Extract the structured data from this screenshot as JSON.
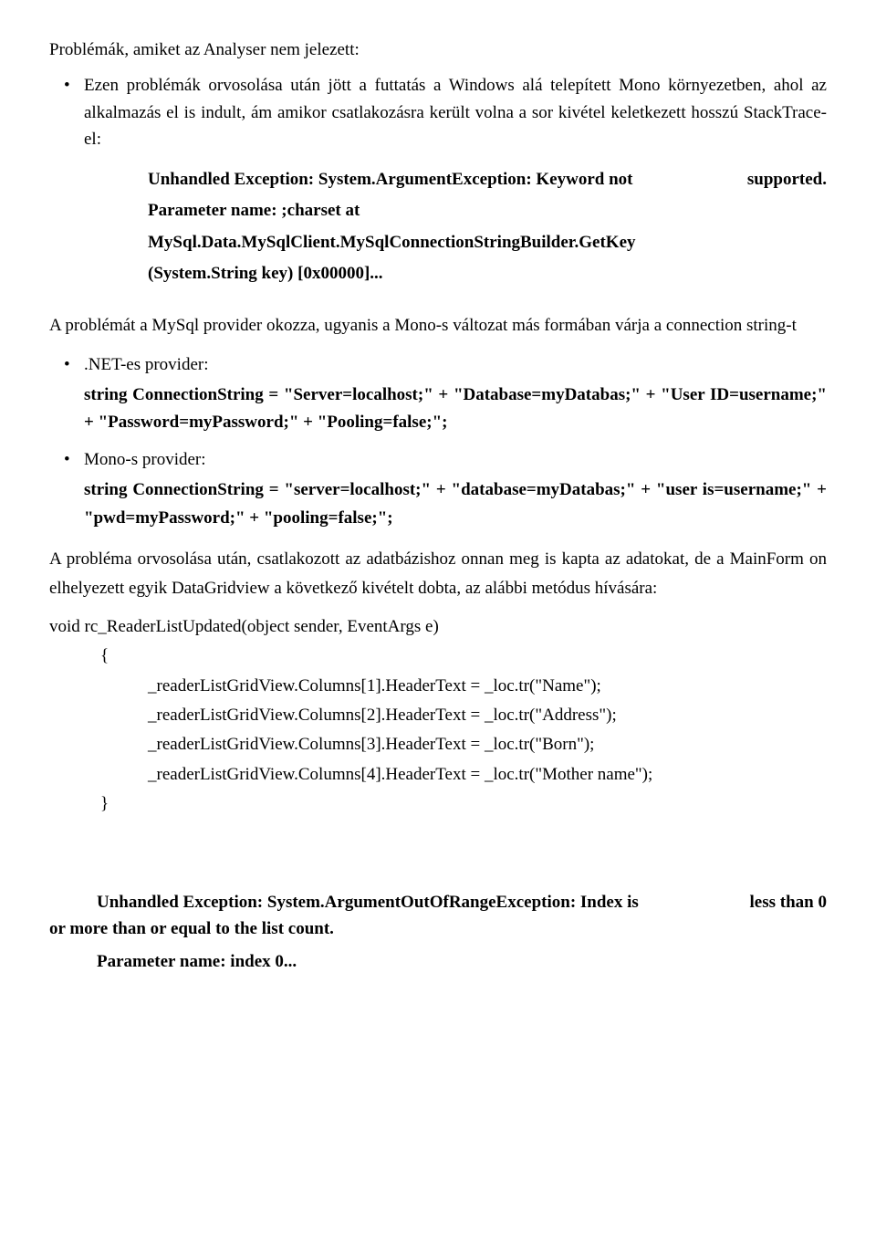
{
  "title": "Problémák, amiket az Analyser nem jelezett:",
  "bullet1": "Ezen problémák orvosolása után jött a futtatás a Windows alá telepített Mono környezetben, ahol az alkalmazás el is indult, ám amikor csatlakozásra került volna a sor kivétel keletkezett hosszú StackTrace-el:",
  "stack1": {
    "l1_left": "Unhandled Exception: System.ArgumentException: Keyword not",
    "l1_right": "supported.",
    "l2": "Parameter name: ;charset at",
    "l3": "MySql.Data.MySqlClient.MySqlConnectionStringBuilder.GetKey",
    "l4": "(System.String key) [0x00000]..."
  },
  "para1": "A problémát a MySql provider okozza, ugyanis a Mono-s változat más formában várja a connection string-t",
  "provider_net_label": ".NET-es provider:",
  "provider_net_code": "string ConnectionString = \"Server=localhost;\" + \"Database=myDatabas;\" + \"User ID=username;\" + \"Password=myPassword;\" + \"Pooling=false;\";",
  "provider_mono_label": "Mono-s provider:",
  "provider_mono_code": "string ConnectionString = \"server=localhost;\" + \"database=myDatabas;\" + \"user is=username;\" + \"pwd=myPassword;\" + \"pooling=false;\";",
  "para2": "A probléma orvosolása után, csatlakozott az adatbázishoz onnan meg is kapta az adatokat, de a MainForm on elhelyezett egyik DataGridview a következő kivételt dobta, az alábbi metódus hívására:",
  "code": {
    "sig": "void rc_ReaderListUpdated(object sender, EventArgs e)",
    "open": "{",
    "l1": "_readerListGridView.Columns[1].HeaderText = _loc.tr(\"Name\");",
    "l2": "_readerListGridView.Columns[2].HeaderText = _loc.tr(\"Address\");",
    "l3": "_readerListGridView.Columns[3].HeaderText = _loc.tr(\"Born\");",
    "l4": "_readerListGridView.Columns[4].HeaderText = _loc.tr(\"Mother name\");",
    "close": "}"
  },
  "stack2": {
    "l1_left": "Unhandled Exception: System.ArgumentOutOfRangeException: Index is",
    "l1_right": "less than 0",
    "l2": "or more than or equal to the list count.",
    "l3": "Parameter name: index 0..."
  }
}
